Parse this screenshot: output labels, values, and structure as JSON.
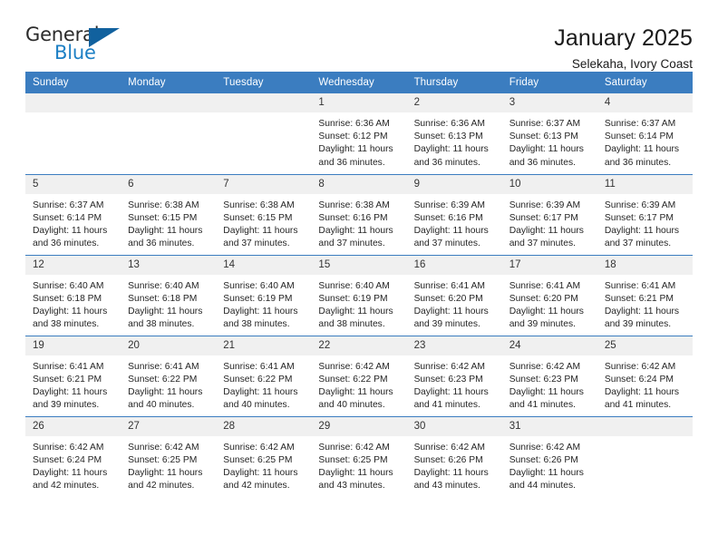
{
  "brand": {
    "name_line1": "General",
    "name_line2": "Blue",
    "triangle_icon": "triangle-icon",
    "color_dark": "#2b2b2b",
    "color_blue": "#1c7fc4"
  },
  "header": {
    "title": "January 2025",
    "subtitle": "Selekaha, Ivory Coast"
  },
  "theme": {
    "header_blue": "#3b7dc0",
    "daynum_band": "#f0f0f0",
    "cell_bg": "#ffffff",
    "text": "#252525"
  },
  "weekday_headers": [
    "Sunday",
    "Monday",
    "Tuesday",
    "Wednesday",
    "Thursday",
    "Friday",
    "Saturday"
  ],
  "labels": {
    "sunrise_prefix": "Sunrise:",
    "sunset_prefix": "Sunset:",
    "daylight_prefix": "Daylight:"
  },
  "weeks": [
    [
      {
        "day": "",
        "empty": true,
        "sunrise": "",
        "sunset": "",
        "daylight_line1": "",
        "daylight_line2": ""
      },
      {
        "day": "",
        "empty": true,
        "sunrise": "",
        "sunset": "",
        "daylight_line1": "",
        "daylight_line2": ""
      },
      {
        "day": "",
        "empty": true,
        "sunrise": "",
        "sunset": "",
        "daylight_line1": "",
        "daylight_line2": ""
      },
      {
        "day": "1",
        "empty": false,
        "sunrise": "Sunrise: 6:36 AM",
        "sunset": "Sunset: 6:12 PM",
        "daylight_line1": "Daylight: 11 hours",
        "daylight_line2": "and 36 minutes."
      },
      {
        "day": "2",
        "empty": false,
        "sunrise": "Sunrise: 6:36 AM",
        "sunset": "Sunset: 6:13 PM",
        "daylight_line1": "Daylight: 11 hours",
        "daylight_line2": "and 36 minutes."
      },
      {
        "day": "3",
        "empty": false,
        "sunrise": "Sunrise: 6:37 AM",
        "sunset": "Sunset: 6:13 PM",
        "daylight_line1": "Daylight: 11 hours",
        "daylight_line2": "and 36 minutes."
      },
      {
        "day": "4",
        "empty": false,
        "sunrise": "Sunrise: 6:37 AM",
        "sunset": "Sunset: 6:14 PM",
        "daylight_line1": "Daylight: 11 hours",
        "daylight_line2": "and 36 minutes."
      }
    ],
    [
      {
        "day": "5",
        "empty": false,
        "sunrise": "Sunrise: 6:37 AM",
        "sunset": "Sunset: 6:14 PM",
        "daylight_line1": "Daylight: 11 hours",
        "daylight_line2": "and 36 minutes."
      },
      {
        "day": "6",
        "empty": false,
        "sunrise": "Sunrise: 6:38 AM",
        "sunset": "Sunset: 6:15 PM",
        "daylight_line1": "Daylight: 11 hours",
        "daylight_line2": "and 36 minutes."
      },
      {
        "day": "7",
        "empty": false,
        "sunrise": "Sunrise: 6:38 AM",
        "sunset": "Sunset: 6:15 PM",
        "daylight_line1": "Daylight: 11 hours",
        "daylight_line2": "and 37 minutes."
      },
      {
        "day": "8",
        "empty": false,
        "sunrise": "Sunrise: 6:38 AM",
        "sunset": "Sunset: 6:16 PM",
        "daylight_line1": "Daylight: 11 hours",
        "daylight_line2": "and 37 minutes."
      },
      {
        "day": "9",
        "empty": false,
        "sunrise": "Sunrise: 6:39 AM",
        "sunset": "Sunset: 6:16 PM",
        "daylight_line1": "Daylight: 11 hours",
        "daylight_line2": "and 37 minutes."
      },
      {
        "day": "10",
        "empty": false,
        "sunrise": "Sunrise: 6:39 AM",
        "sunset": "Sunset: 6:17 PM",
        "daylight_line1": "Daylight: 11 hours",
        "daylight_line2": "and 37 minutes."
      },
      {
        "day": "11",
        "empty": false,
        "sunrise": "Sunrise: 6:39 AM",
        "sunset": "Sunset: 6:17 PM",
        "daylight_line1": "Daylight: 11 hours",
        "daylight_line2": "and 37 minutes."
      }
    ],
    [
      {
        "day": "12",
        "empty": false,
        "sunrise": "Sunrise: 6:40 AM",
        "sunset": "Sunset: 6:18 PM",
        "daylight_line1": "Daylight: 11 hours",
        "daylight_line2": "and 38 minutes."
      },
      {
        "day": "13",
        "empty": false,
        "sunrise": "Sunrise: 6:40 AM",
        "sunset": "Sunset: 6:18 PM",
        "daylight_line1": "Daylight: 11 hours",
        "daylight_line2": "and 38 minutes."
      },
      {
        "day": "14",
        "empty": false,
        "sunrise": "Sunrise: 6:40 AM",
        "sunset": "Sunset: 6:19 PM",
        "daylight_line1": "Daylight: 11 hours",
        "daylight_line2": "and 38 minutes."
      },
      {
        "day": "15",
        "empty": false,
        "sunrise": "Sunrise: 6:40 AM",
        "sunset": "Sunset: 6:19 PM",
        "daylight_line1": "Daylight: 11 hours",
        "daylight_line2": "and 38 minutes."
      },
      {
        "day": "16",
        "empty": false,
        "sunrise": "Sunrise: 6:41 AM",
        "sunset": "Sunset: 6:20 PM",
        "daylight_line1": "Daylight: 11 hours",
        "daylight_line2": "and 39 minutes."
      },
      {
        "day": "17",
        "empty": false,
        "sunrise": "Sunrise: 6:41 AM",
        "sunset": "Sunset: 6:20 PM",
        "daylight_line1": "Daylight: 11 hours",
        "daylight_line2": "and 39 minutes."
      },
      {
        "day": "18",
        "empty": false,
        "sunrise": "Sunrise: 6:41 AM",
        "sunset": "Sunset: 6:21 PM",
        "daylight_line1": "Daylight: 11 hours",
        "daylight_line2": "and 39 minutes."
      }
    ],
    [
      {
        "day": "19",
        "empty": false,
        "sunrise": "Sunrise: 6:41 AM",
        "sunset": "Sunset: 6:21 PM",
        "daylight_line1": "Daylight: 11 hours",
        "daylight_line2": "and 39 minutes."
      },
      {
        "day": "20",
        "empty": false,
        "sunrise": "Sunrise: 6:41 AM",
        "sunset": "Sunset: 6:22 PM",
        "daylight_line1": "Daylight: 11 hours",
        "daylight_line2": "and 40 minutes."
      },
      {
        "day": "21",
        "empty": false,
        "sunrise": "Sunrise: 6:41 AM",
        "sunset": "Sunset: 6:22 PM",
        "daylight_line1": "Daylight: 11 hours",
        "daylight_line2": "and 40 minutes."
      },
      {
        "day": "22",
        "empty": false,
        "sunrise": "Sunrise: 6:42 AM",
        "sunset": "Sunset: 6:22 PM",
        "daylight_line1": "Daylight: 11 hours",
        "daylight_line2": "and 40 minutes."
      },
      {
        "day": "23",
        "empty": false,
        "sunrise": "Sunrise: 6:42 AM",
        "sunset": "Sunset: 6:23 PM",
        "daylight_line1": "Daylight: 11 hours",
        "daylight_line2": "and 41 minutes."
      },
      {
        "day": "24",
        "empty": false,
        "sunrise": "Sunrise: 6:42 AM",
        "sunset": "Sunset: 6:23 PM",
        "daylight_line1": "Daylight: 11 hours",
        "daylight_line2": "and 41 minutes."
      },
      {
        "day": "25",
        "empty": false,
        "sunrise": "Sunrise: 6:42 AM",
        "sunset": "Sunset: 6:24 PM",
        "daylight_line1": "Daylight: 11 hours",
        "daylight_line2": "and 41 minutes."
      }
    ],
    [
      {
        "day": "26",
        "empty": false,
        "sunrise": "Sunrise: 6:42 AM",
        "sunset": "Sunset: 6:24 PM",
        "daylight_line1": "Daylight: 11 hours",
        "daylight_line2": "and 42 minutes."
      },
      {
        "day": "27",
        "empty": false,
        "sunrise": "Sunrise: 6:42 AM",
        "sunset": "Sunset: 6:25 PM",
        "daylight_line1": "Daylight: 11 hours",
        "daylight_line2": "and 42 minutes."
      },
      {
        "day": "28",
        "empty": false,
        "sunrise": "Sunrise: 6:42 AM",
        "sunset": "Sunset: 6:25 PM",
        "daylight_line1": "Daylight: 11 hours",
        "daylight_line2": "and 42 minutes."
      },
      {
        "day": "29",
        "empty": false,
        "sunrise": "Sunrise: 6:42 AM",
        "sunset": "Sunset: 6:25 PM",
        "daylight_line1": "Daylight: 11 hours",
        "daylight_line2": "and 43 minutes."
      },
      {
        "day": "30",
        "empty": false,
        "sunrise": "Sunrise: 6:42 AM",
        "sunset": "Sunset: 6:26 PM",
        "daylight_line1": "Daylight: 11 hours",
        "daylight_line2": "and 43 minutes."
      },
      {
        "day": "31",
        "empty": false,
        "sunrise": "Sunrise: 6:42 AM",
        "sunset": "Sunset: 6:26 PM",
        "daylight_line1": "Daylight: 11 hours",
        "daylight_line2": "and 44 minutes."
      },
      {
        "day": "",
        "empty": true,
        "sunrise": "",
        "sunset": "",
        "daylight_line1": "",
        "daylight_line2": ""
      }
    ]
  ]
}
